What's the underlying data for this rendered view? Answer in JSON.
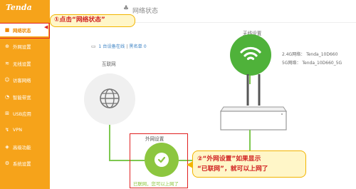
{
  "app": {
    "logo": "Tenda"
  },
  "sidebar": {
    "items": [
      {
        "label": "网络状态",
        "icon": "network-icon",
        "glyph": "■",
        "active": true
      },
      {
        "label": "外网设置",
        "icon": "globe-icon",
        "glyph": "⊕"
      },
      {
        "label": "无线设置",
        "icon": "wifi-icon",
        "glyph": "≋"
      },
      {
        "label": "访客网络",
        "icon": "guest-icon",
        "glyph": "☺"
      },
      {
        "label": "智能带宽",
        "icon": "bandwidth-icon",
        "glyph": "◔"
      },
      {
        "label": "USB应用",
        "icon": "usb-icon",
        "glyph": "⊞"
      },
      {
        "label": "VPN",
        "icon": "vpn-icon",
        "glyph": "↯"
      },
      {
        "label": "高级功能",
        "icon": "advanced-icon",
        "glyph": "◈"
      },
      {
        "label": "系统设置",
        "icon": "settings-icon",
        "glyph": "⚙"
      }
    ]
  },
  "header": {
    "title": "网络状态",
    "icon_glyph": "♣"
  },
  "callouts": {
    "step1": "①点击“网络状态”",
    "step2_line1": "②“外网设置”如果显示",
    "step2_line2": "“已联网”，就可以上网了"
  },
  "topology": {
    "devices_online_link": "1 台设备在线",
    "separator": " | ",
    "blacklist": "黑名单 0",
    "internet_label": "互联网",
    "wireless_label": "无线设置",
    "wifi_24": "2.4G网络：  Tenda_10D660",
    "wifi_5": "5G网络：  Tenda_10D660_5G",
    "wan_label": "外网设置",
    "wan_status": "已联网，您可以上网了"
  },
  "colors": {
    "sidebar": "#f6a31a",
    "highlight_red": "#e02020",
    "wifi_green": "#4fb23a",
    "wan_green": "#8cc63f",
    "callout_bg": "#fff6c8"
  }
}
